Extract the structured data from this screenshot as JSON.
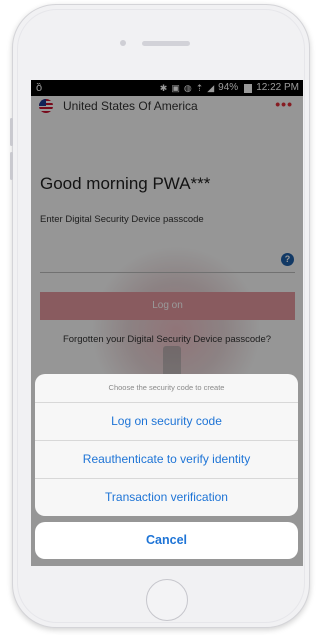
{
  "status_bar": {
    "left_icon": "notification-icon",
    "battery_percent": "94%",
    "time": "12:22 PM"
  },
  "header": {
    "country": "United States Of America",
    "more_icon": "more-dots-icon"
  },
  "login": {
    "greeting": "Good morning PWA***",
    "prompt": "Enter Digital Security Device passcode",
    "help_icon": "?",
    "logon_label": "Log on",
    "forgot_text": "Forgotten your Digital Security Device passcode?"
  },
  "action_sheet": {
    "title": "Choose the security code to create",
    "options": [
      {
        "label": "Log on security code"
      },
      {
        "label": "Reauthenticate to verify identity"
      },
      {
        "label": "Transaction verification"
      }
    ],
    "cancel_label": "Cancel"
  },
  "colors": {
    "accent": "#1e74d6",
    "brand_red": "#e0303a",
    "logon_button": "#e5989f"
  }
}
